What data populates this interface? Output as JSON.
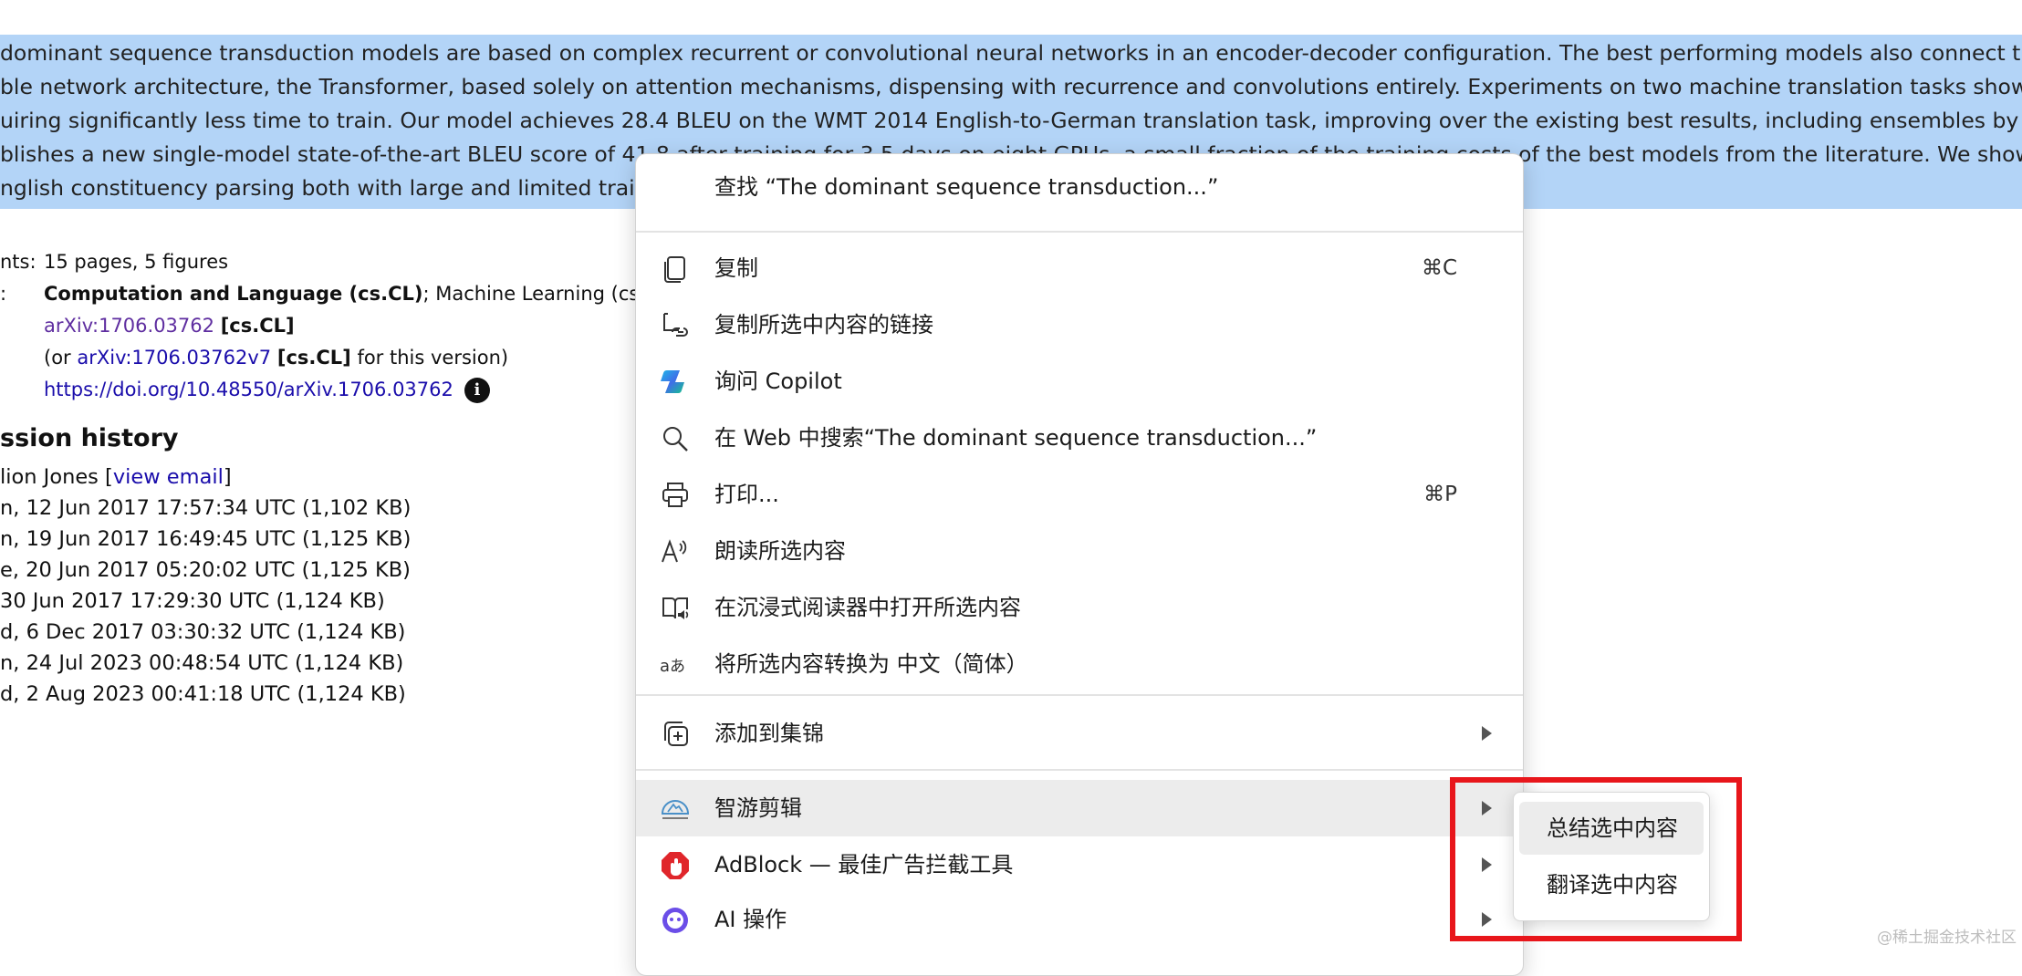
{
  "abstract_lines": [
    "dominant sequence transduction models are based on complex recurrent or convolutional neural networks in an encoder-decoder configuration. The best performing models also connect the",
    "ble network architecture, the Transformer, based solely on attention mechanisms, dispensing with recurrence and convolutions entirely. Experiments on two machine translation tasks show the",
    "uiring significantly less time to train. Our model achieves 28.4 BLEU on the WMT 2014 English-to-German translation task, improving over the existing best results, including ensembles by ove",
    "blishes a new single-model state-of-the-art BLEU score of 41.8 after training for 3.5 days on eight GPUs, a small fraction of the training costs of the best models from the literature. We show",
    "nglish constituency parsing both with large and limited train"
  ],
  "meta": {
    "comments_key": "nts:",
    "comments_value": "15 pages, 5 figures",
    "subjects_key": ":",
    "subjects_primary": "Computation and Language (cs.CL)",
    "subjects_rest": "; Machine Learning (cs.LG)",
    "arxiv_id": "arXiv:1706.03762",
    "arxiv_cat": "[cs.CL]",
    "version_prefix": "(or ",
    "version_id": "arXiv:1706.03762v7",
    "version_cat": "[cs.CL]",
    "version_suffix": " for this version)",
    "doi": "https://doi.org/10.48550/arXiv.1706.03762",
    "info_glyph": "i"
  },
  "history": {
    "title": "ssion history",
    "from_prefix": "lion Jones [",
    "view_email": "view email",
    "from_suffix": "]",
    "entries": [
      "n, 12 Jun 2017 17:57:34 UTC (1,102 KB)",
      "n, 19 Jun 2017 16:49:45 UTC (1,125 KB)",
      "e, 20 Jun 2017 05:20:02 UTC (1,125 KB)",
      " 30 Jun 2017 17:29:30 UTC (1,124 KB)",
      "d, 6 Dec 2017 03:30:32 UTC (1,124 KB)",
      "n, 24 Jul 2023 00:48:54 UTC (1,124 KB)",
      "d, 2 Aug 2023 00:41:18 UTC (1,124 KB)"
    ]
  },
  "menu": {
    "find": "查找 “The dominant sequence transduction...”",
    "copy": "复制",
    "copy_shortcut": "⌘C",
    "copy_link": "复制所选中内容的链接",
    "ask_copilot": "询问 Copilot",
    "web_search": "在 Web 中搜索“The dominant sequence transduction...”",
    "print": "打印...",
    "print_shortcut": "⌘P",
    "read_aloud": "朗读所选内容",
    "immersive_reader": "在沉浸式阅读器中打开所选内容",
    "translate_to": "将所选内容转换为 中文（简体）",
    "add_collections": "添加到集锦",
    "smart_clip": "智游剪辑",
    "adblock": "AdBlock — 最佳广告拦截工具",
    "ai_ops": "AI 操作"
  },
  "submenu": {
    "summarize": "总结选中内容",
    "translate": "翻译选中内容"
  },
  "colors": {
    "selection": "#b3d4f7",
    "highlight_box": "#e8161b",
    "adblock_red": "#e0262b"
  },
  "icons": [
    "copy-icon",
    "copy-link-icon",
    "copilot-icon",
    "search-icon",
    "print-icon",
    "read-aloud-icon",
    "immersive-reader-icon",
    "translate-icon",
    "collections-icon",
    "smart-clip-icon",
    "adblock-icon",
    "ai-ops-icon"
  ],
  "watermark": "@稀土掘金技术社区"
}
